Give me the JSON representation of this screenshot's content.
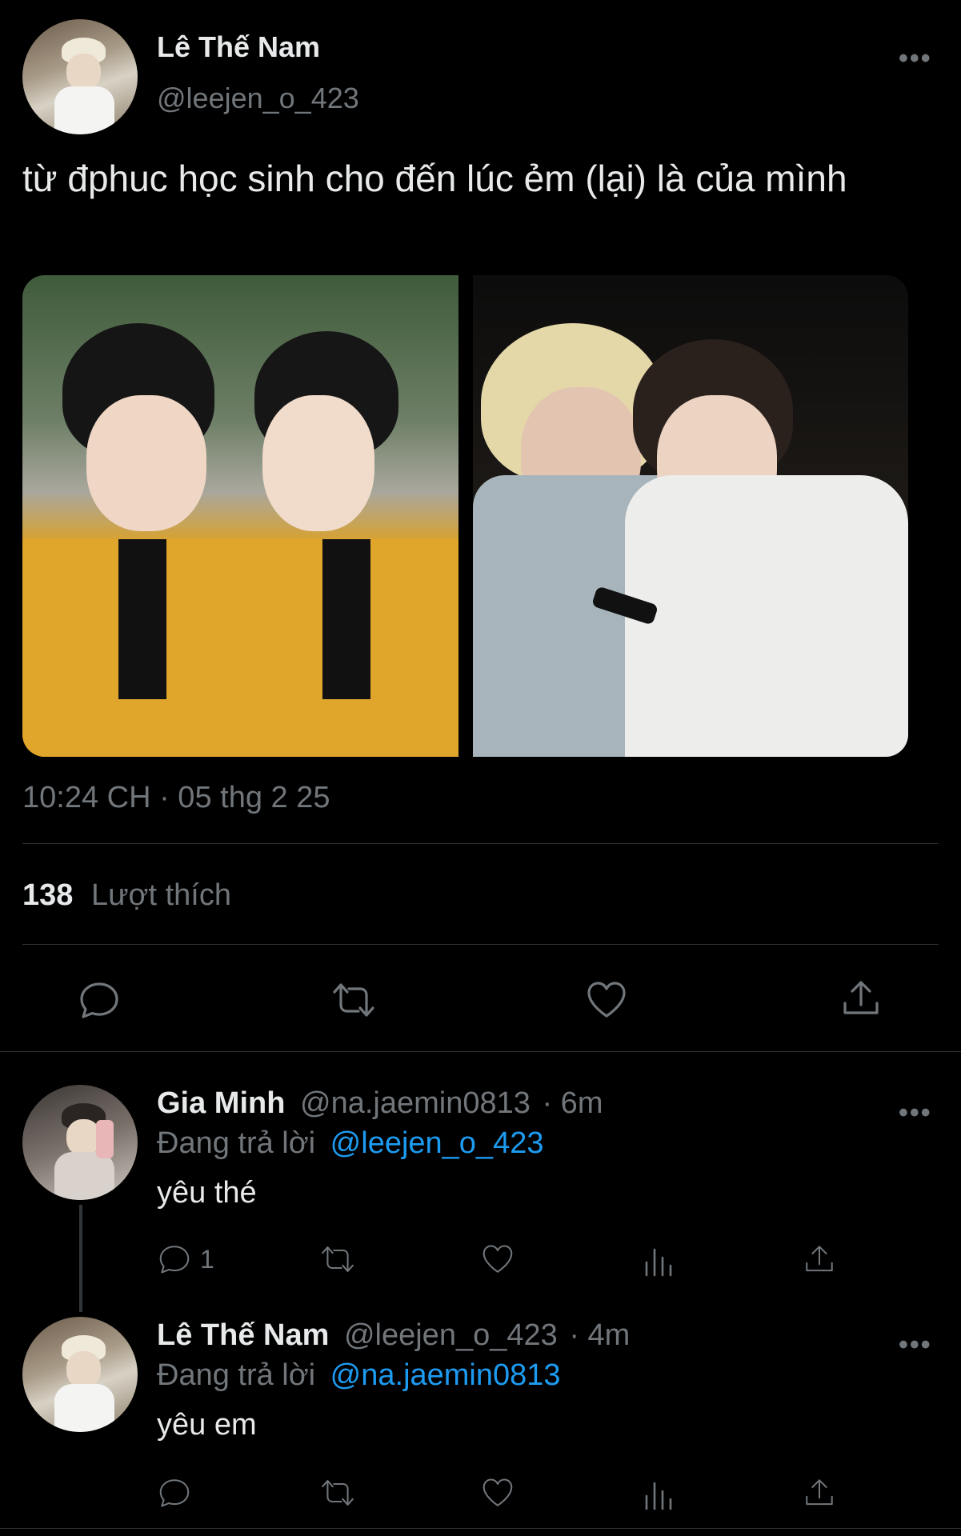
{
  "tweet": {
    "author_name": "Lê Thế Nam",
    "author_handle": "@leejen_o_423",
    "more": "•••",
    "text": "từ đphuc học sinh cho đến lúc ẻm (lại) là của mình",
    "timestamp": "10:24 CH · 05 thg 2 25",
    "likes_count": "138",
    "likes_label": "Lượt thích"
  },
  "replies": [
    {
      "name": "Gia Minh",
      "handle": "@na.jaemin0813",
      "time": "· 6m",
      "replying_prefix": "Đang trả lời",
      "replying_to": "@leejen_o_423",
      "text": "yêu thé",
      "reply_count": "1",
      "more": "•••"
    },
    {
      "name": "Lê Thế Nam",
      "handle": "@leejen_o_423",
      "time": "· 4m",
      "replying_prefix": "Đang trả lời",
      "replying_to": "@na.jaemin0813",
      "text": "yêu em",
      "reply_count": "",
      "more": "•••"
    }
  ],
  "icons": {
    "reply": "speech-bubble-icon",
    "retweet": "retweet-icon",
    "like": "heart-icon",
    "share": "share-icon",
    "views": "bar-chart-icon"
  },
  "colors": {
    "background": "#000000",
    "text": "#e7e9ea",
    "muted": "#71767b",
    "link": "#1d9bf0",
    "divider": "#2f3336"
  }
}
